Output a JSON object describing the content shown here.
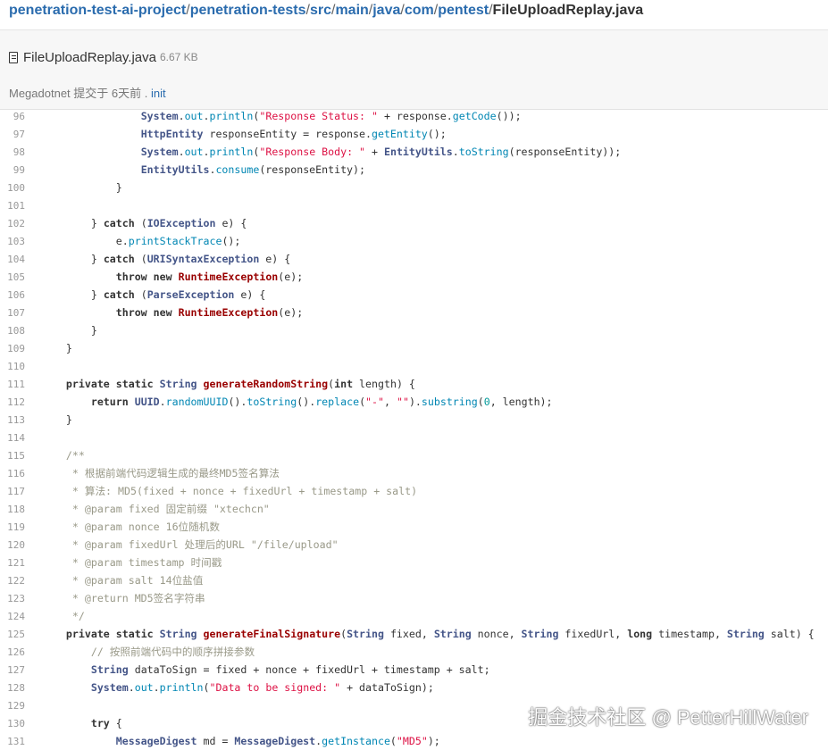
{
  "breadcrumb": {
    "parts": [
      "penetration-test-ai-project",
      "penetration-tests",
      "src",
      "main",
      "java",
      "com",
      "pentest"
    ],
    "current": "FileUploadReplay.java",
    "sep": "/"
  },
  "file": {
    "name": "FileUploadReplay.java",
    "size": "6.67 KB",
    "author": "Megadotnet",
    "commit_text": "提交于 6天前 .",
    "commit_message": "init"
  },
  "code": {
    "lines": [
      {
        "n": "96",
        "t": "                System.out.println(\"Response Status: \" + response.getCode());"
      },
      {
        "n": "97",
        "t": "                HttpEntity responseEntity = response.getEntity();"
      },
      {
        "n": "98",
        "t": "                System.out.println(\"Response Body: \" + EntityUtils.toString(responseEntity));"
      },
      {
        "n": "99",
        "t": "                EntityUtils.consume(responseEntity);"
      },
      {
        "n": "100",
        "t": "            }"
      },
      {
        "n": "101",
        "t": ""
      },
      {
        "n": "102",
        "t": "        } catch (IOException e) {"
      },
      {
        "n": "103",
        "t": "            e.printStackTrace();"
      },
      {
        "n": "104",
        "t": "        } catch (URISyntaxException e) {"
      },
      {
        "n": "105",
        "t": "            throw new RuntimeException(e);"
      },
      {
        "n": "106",
        "t": "        } catch (ParseException e) {"
      },
      {
        "n": "107",
        "t": "            throw new RuntimeException(e);"
      },
      {
        "n": "108",
        "t": "        }"
      },
      {
        "n": "109",
        "t": "    }"
      },
      {
        "n": "110",
        "t": ""
      },
      {
        "n": "111",
        "t": "    private static String generateRandomString(int length) {"
      },
      {
        "n": "112",
        "t": "        return UUID.randomUUID().toString().replace(\"-\", \"\").substring(0, length);"
      },
      {
        "n": "113",
        "t": "    }"
      },
      {
        "n": "114",
        "t": ""
      },
      {
        "n": "115",
        "t": "    /**"
      },
      {
        "n": "116",
        "t": "     * 根据前端代码逻辑生成的最终MD5签名算法"
      },
      {
        "n": "117",
        "t": "     * 算法: MD5(fixed + nonce + fixedUrl + timestamp + salt)"
      },
      {
        "n": "118",
        "t": "     * @param fixed 固定前缀 \"xtechcn\""
      },
      {
        "n": "119",
        "t": "     * @param nonce 16位随机数"
      },
      {
        "n": "120",
        "t": "     * @param fixedUrl 处理后的URL \"/file/upload\""
      },
      {
        "n": "121",
        "t": "     * @param timestamp 时间戳"
      },
      {
        "n": "122",
        "t": "     * @param salt 14位盐值"
      },
      {
        "n": "123",
        "t": "     * @return MD5签名字符串"
      },
      {
        "n": "124",
        "t": "     */"
      },
      {
        "n": "125",
        "t": "    private static String generateFinalSignature(String fixed, String nonce, String fixedUrl, long timestamp, String salt) {"
      },
      {
        "n": "126",
        "t": "        // 按照前端代码中的顺序拼接参数"
      },
      {
        "n": "127",
        "t": "        String dataToSign = fixed + nonce + fixedUrl + timestamp + salt;"
      },
      {
        "n": "128",
        "t": "        System.out.println(\"Data to be signed: \" + dataToSign);"
      },
      {
        "n": "129",
        "t": ""
      },
      {
        "n": "130",
        "t": "        try {"
      },
      {
        "n": "131",
        "t": "            MessageDigest md = MessageDigest.getInstance(\"MD5\");"
      }
    ]
  },
  "watermark": "掘金技术社区 @ PetterHillWater",
  "colors": {
    "link": "#2b6cae",
    "keyword": "#333333",
    "type": "#445588",
    "method": "#0086b3",
    "string": "#dd1144",
    "comment": "#999988",
    "exception": "#990000",
    "number": "#009999"
  }
}
